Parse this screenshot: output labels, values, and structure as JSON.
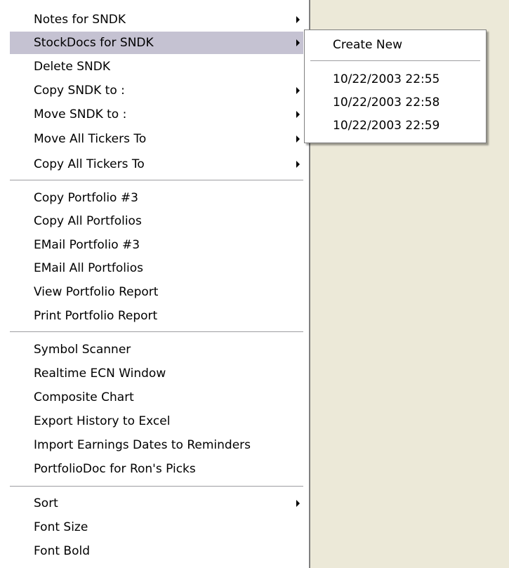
{
  "colors": {
    "highlight": "#c5c2d2",
    "background_area": "#ece9d8",
    "menu_background": "#ffffff",
    "separator": "#9d9da1"
  },
  "context_menu": {
    "group1": [
      {
        "label": "Notes for SNDK",
        "has_submenu": true,
        "icon": "chevron-right-icon"
      },
      {
        "label": "StockDocs for SNDK",
        "has_submenu": true,
        "highlighted": true,
        "icon": "chevron-right-icon"
      },
      {
        "label": "Delete SNDK",
        "has_submenu": false
      },
      {
        "label": "Copy SNDK to :",
        "has_submenu": true,
        "icon": "chevron-right-icon"
      },
      {
        "label": "Move SNDK to :",
        "has_submenu": true,
        "icon": "chevron-right-icon"
      },
      {
        "label": "Move All Tickers To",
        "has_submenu": true,
        "icon": "chevron-right-icon"
      },
      {
        "label": "Copy All Tickers To",
        "has_submenu": true,
        "icon": "chevron-right-icon"
      }
    ],
    "group2": [
      {
        "label": "Copy Portfolio #3"
      },
      {
        "label": "Copy All Portfolios"
      },
      {
        "label": "EMail Portfolio #3"
      },
      {
        "label": "EMail All Portfolios"
      },
      {
        "label": "View Portfolio Report"
      },
      {
        "label": "Print Portfolio Report"
      }
    ],
    "group3": [
      {
        "label": "Symbol Scanner"
      },
      {
        "label": "Realtime ECN Window"
      },
      {
        "label": "Composite Chart"
      },
      {
        "label": "Export History to Excel"
      },
      {
        "label": "Import Earnings Dates to Reminders"
      },
      {
        "label": "PortfolioDoc for Ron's Picks"
      }
    ],
    "group4": [
      {
        "label": "Sort",
        "has_submenu": true,
        "icon": "chevron-right-icon"
      },
      {
        "label": "Font Size"
      },
      {
        "label": "Font Bold"
      }
    ]
  },
  "submenu": {
    "create_new": "Create New",
    "documents": [
      {
        "label": "10/22/2003 22:55"
      },
      {
        "label": "10/22/2003 22:58"
      },
      {
        "label": "10/22/2003 22:59"
      }
    ]
  }
}
